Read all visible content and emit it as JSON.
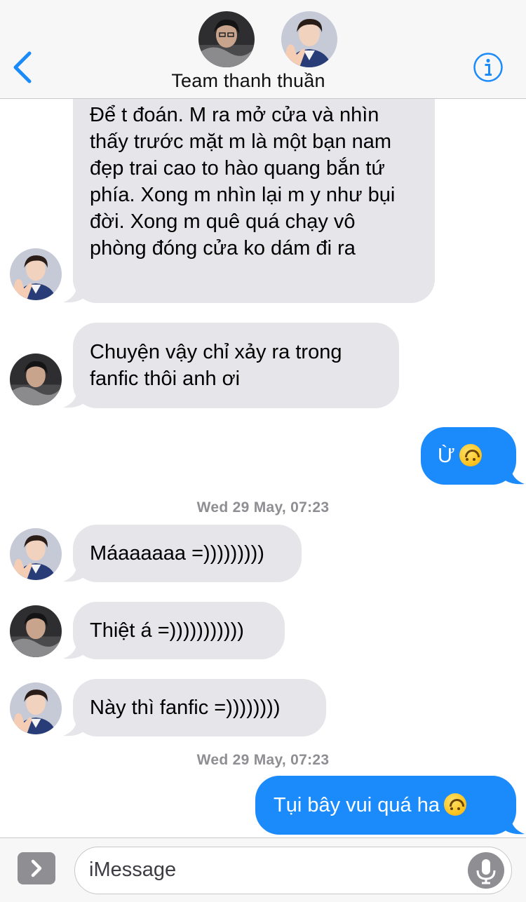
{
  "header": {
    "title": "Team thanh thuần",
    "back_icon": "chevron-left-icon",
    "info_icon": "info-icon",
    "accent": "#1b8bfb"
  },
  "messages": [
    {
      "direction": "in",
      "sender": "friend-b",
      "text": "Để t đoán. M ra mở cửa và nhìn thấy trước mặt m là một bạn nam đẹp trai cao to hào quang bắn tứ phía. Xong m nhìn lại m y như bụi đời. Xong m quê quá chạy vô phòng đóng cửa ko dám đi ra"
    },
    {
      "direction": "in",
      "sender": "friend-a",
      "text": "Chuyện vậy chỉ xảy ra trong fanfic thôi anh ơi"
    },
    {
      "direction": "out",
      "text": "Ừ",
      "emoji": "upside-down-face"
    },
    {
      "timestamp": "Wed 29 May, 07:23"
    },
    {
      "direction": "in",
      "sender": "friend-b",
      "text": "Máaaaaaa =)))))))))"
    },
    {
      "direction": "in",
      "sender": "friend-a",
      "text": "Thiệt á =)))))))))))"
    },
    {
      "direction": "in",
      "sender": "friend-b",
      "text": "Này thì fanfic =))))))))"
    },
    {
      "timestamp": "Wed 29 May, 07:23"
    },
    {
      "direction": "out",
      "text": "Tụi bây vui quá ha",
      "emoji": "upside-down-face"
    }
  ],
  "colors": {
    "incoming_bubble": "#e5e5ea",
    "outgoing_bubble": "#1b8bfb",
    "timestamp": "#8e8e93"
  },
  "input": {
    "placeholder": "iMessage",
    "apps_icon": "chevron-right-icon",
    "mic_icon": "microphone-icon"
  }
}
